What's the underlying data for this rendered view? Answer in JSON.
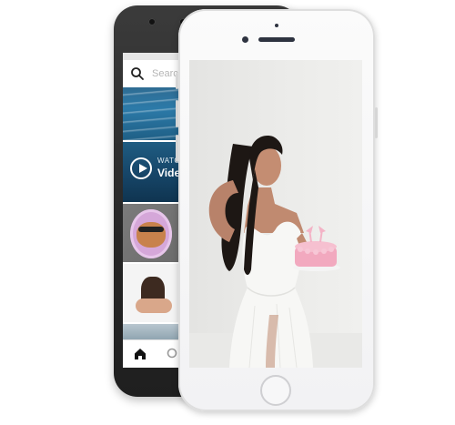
{
  "back_phone": {
    "search": {
      "placeholder": "Search"
    },
    "video_tile": {
      "kicker": "WATCH",
      "title": "Video"
    }
  },
  "colors": {
    "android_body": "#262626",
    "iphone_body": "#f7f7f8",
    "cake_pink": "#f2a9bf",
    "dress_white": "#f7f7f5"
  },
  "icons": {
    "search": "search-icon",
    "play": "play-icon",
    "home": "home-icon",
    "nav_search": "search-icon"
  }
}
